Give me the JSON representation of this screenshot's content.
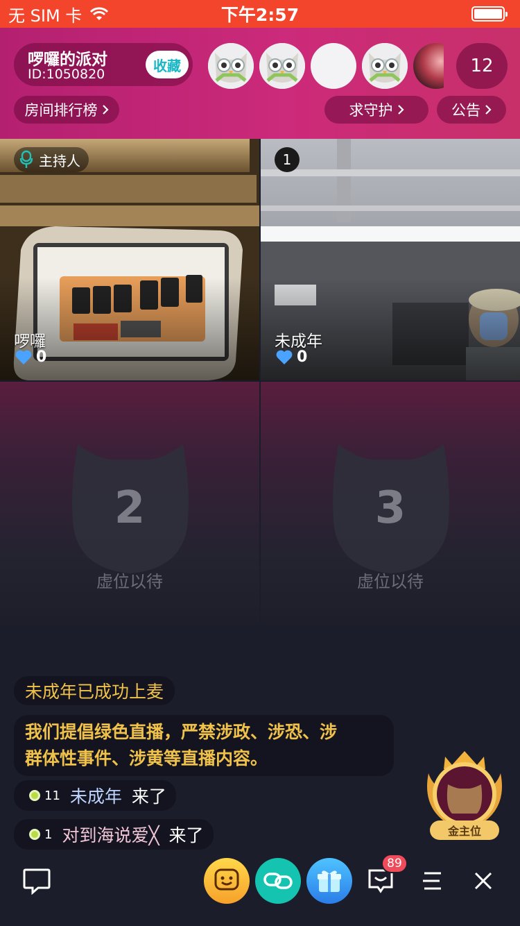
{
  "status_bar": {
    "carrier": "无 SIM 卡",
    "time": "下午2:57"
  },
  "room": {
    "title": "啰囉的派对",
    "id_text": "ID:1050820",
    "favorite_label": "收藏",
    "audience_count": "12",
    "ranking_label": "房间排行榜",
    "guard_label": "求守护",
    "notice_label": "公告"
  },
  "seats": {
    "host": {
      "badge": "主持人",
      "name": "啰囉",
      "likes": "0"
    },
    "seat1": {
      "number": "1",
      "name": "未成年",
      "likes": "0"
    },
    "seat2": {
      "number": "2",
      "label": "虚位以待"
    },
    "seat3": {
      "number": "3",
      "label": "虚位以待"
    }
  },
  "chat": {
    "system_message": "未成年已成功上麦",
    "notice_line1": "我们提倡绿色直播，严禁涉政、涉恐、涉",
    "notice_line2": "群体性事件、涉黄等直播内容。",
    "joins": [
      {
        "level": "11",
        "user": "未成年",
        "action": "来了"
      },
      {
        "level": "1",
        "user": "对到海说爱╳",
        "action": "来了"
      }
    ]
  },
  "gold_seat": {
    "label": "金主位"
  },
  "bottom_bar": {
    "message_badge": "89"
  },
  "colors": {
    "status_bar": "#f2452b",
    "header_pink": "#cc2a7a",
    "accent_teal": "#19b7c6",
    "chat_gold": "#f0c24a",
    "background": "#1c1d2b"
  }
}
